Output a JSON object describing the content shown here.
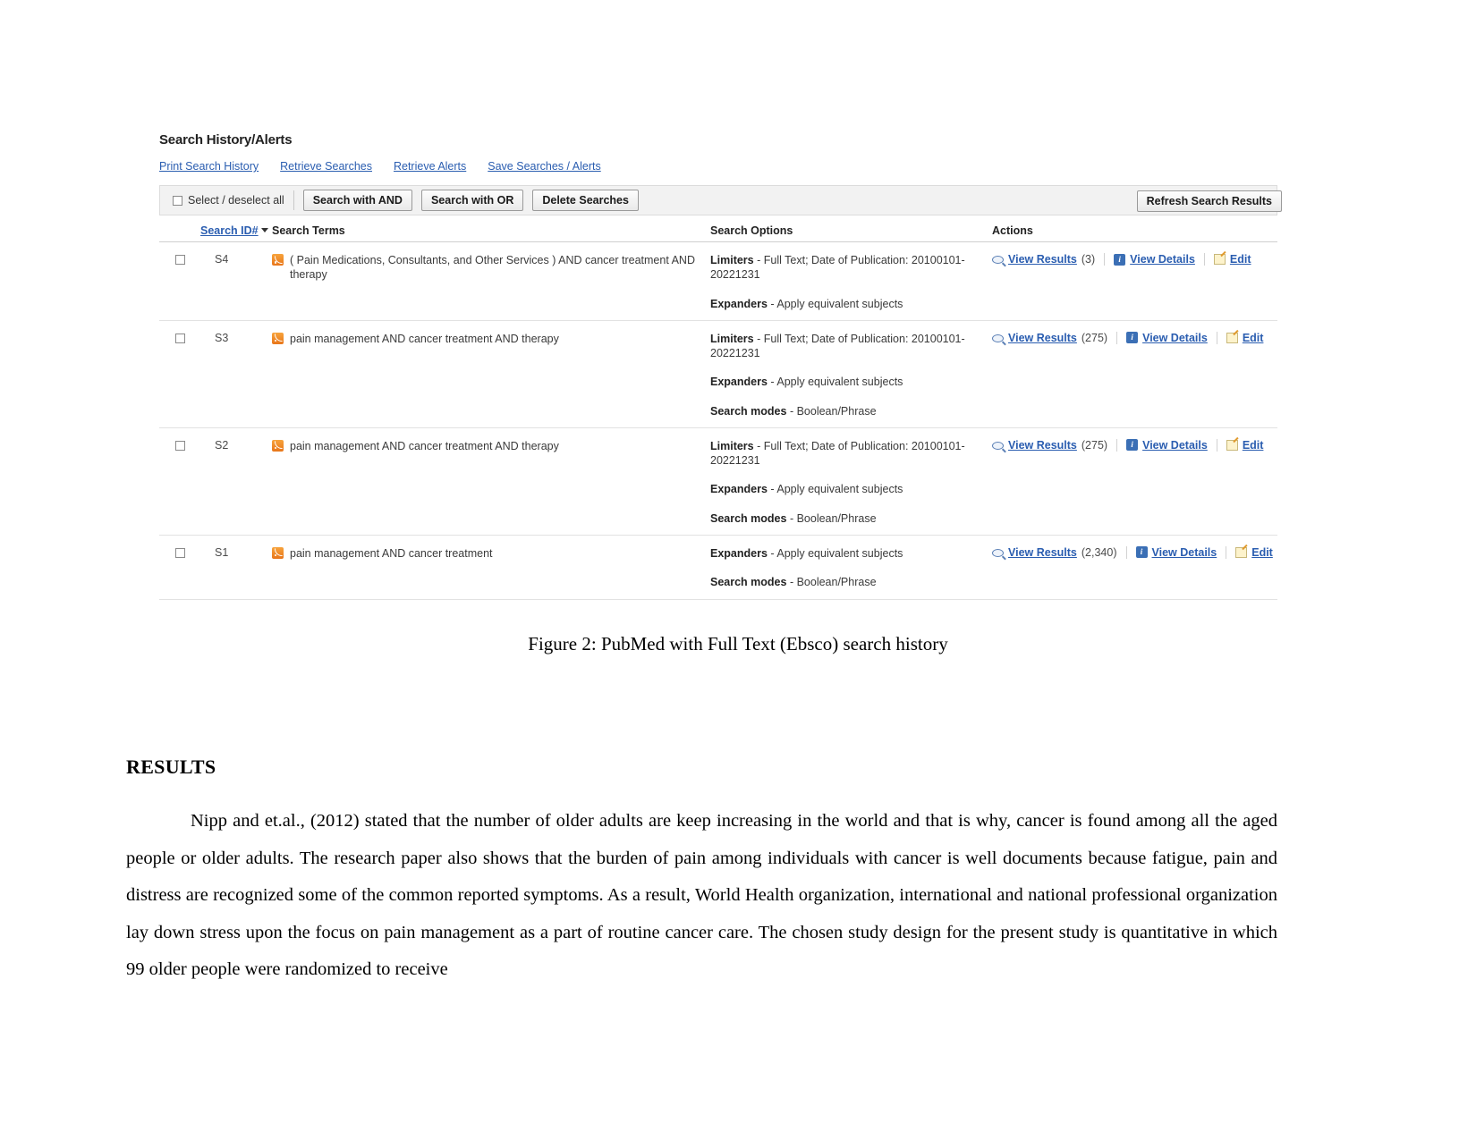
{
  "ebsco": {
    "title": "Search History/Alerts",
    "links": [
      "Print Search History",
      "Retrieve Searches",
      "Retrieve Alerts",
      "Save Searches / Alerts"
    ],
    "toolbar": {
      "select_all_label": "Select / deselect all",
      "search_and_label": "Search with AND",
      "search_or_label": "Search with OR",
      "delete_label": "Delete Searches",
      "refresh_label": "Refresh Search Results"
    },
    "columns": {
      "search_id": "Search ID#",
      "search_terms": "Search Terms",
      "search_options": "Search Options",
      "actions": "Actions"
    },
    "action_labels": {
      "view_results": "View Results",
      "view_details": "View Details",
      "edit": "Edit"
    },
    "rows": [
      {
        "id": "S4",
        "terms": "( Pain Medications, Consultants, and Other Services ) AND cancer treatment AND therapy",
        "options": [
          {
            "label": "Limiters",
            "value": "- Full Text; Date of Publication: 20100101-20221231"
          },
          {
            "label": "Expanders",
            "value": "- Apply equivalent subjects"
          }
        ],
        "result_count": "(3)"
      },
      {
        "id": "S3",
        "terms": "pain management AND cancer treatment AND therapy",
        "options": [
          {
            "label": "Limiters",
            "value": "- Full Text; Date of Publication: 20100101-20221231"
          },
          {
            "label": "Expanders",
            "value": "- Apply equivalent subjects"
          },
          {
            "label": "Search modes",
            "value": "- Boolean/Phrase"
          }
        ],
        "result_count": "(275)"
      },
      {
        "id": "S2",
        "terms": "pain management AND cancer treatment AND therapy",
        "options": [
          {
            "label": "Limiters",
            "value": "- Full Text; Date of Publication: 20100101-20221231"
          },
          {
            "label": "Expanders",
            "value": "- Apply equivalent subjects"
          },
          {
            "label": "Search modes",
            "value": "- Boolean/Phrase"
          }
        ],
        "result_count": "(275)"
      },
      {
        "id": "S1",
        "terms": "pain management AND cancer treatment",
        "options": [
          {
            "label": "Expanders",
            "value": "- Apply equivalent subjects"
          },
          {
            "label": "Search modes",
            "value": "- Boolean/Phrase"
          }
        ],
        "result_count": "(2,340)"
      }
    ]
  },
  "document": {
    "figure_caption": "Figure 2: PubMed with Full Text (Ebsco) search history",
    "results_heading": "RESULTS",
    "results_paragraph": "Nipp and et.al., (2012) stated that the number of older adults are keep increasing in the world and that is why, cancer is found among all the aged people or older adults. The research paper also shows that the burden of pain among individuals with cancer is well documents because fatigue, pain and distress are recognized some of the common reported symptoms. As a result, World Health organization, international and national professional organization lay down stress upon the focus on pain management as a part of routine cancer care. The chosen study design for the present study is quantitative in which 99 older people were randomized to receive"
  }
}
